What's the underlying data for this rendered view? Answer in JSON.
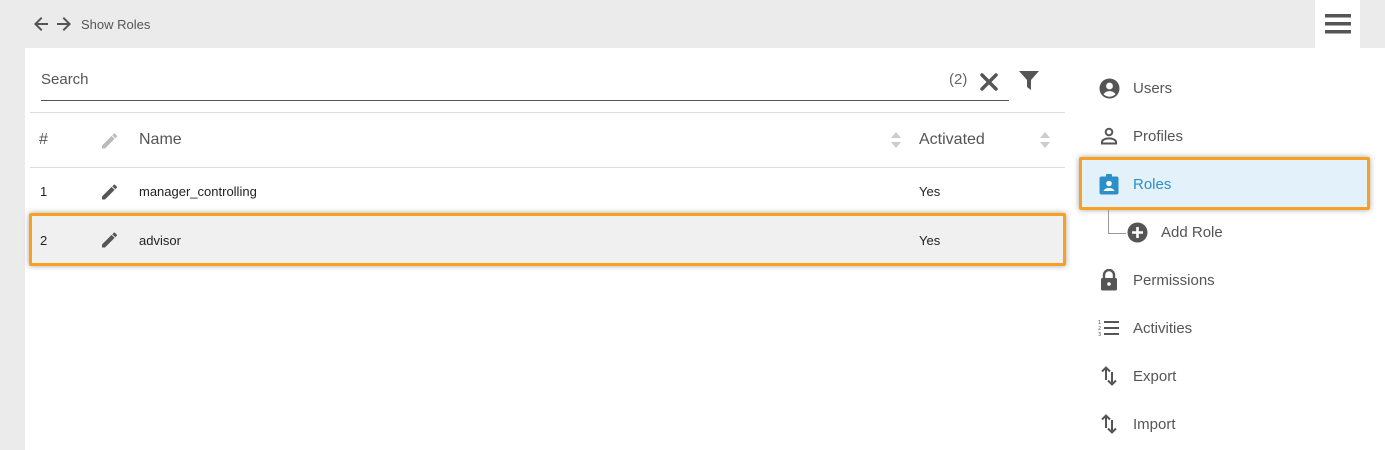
{
  "header": {
    "breadcrumb": "Show Roles"
  },
  "search": {
    "placeholder": "Search",
    "value": "",
    "count": "(2)"
  },
  "table": {
    "columns": {
      "index": "#",
      "name": "Name",
      "activated": "Activated"
    },
    "rows": [
      {
        "index": "1",
        "name": "manager_controlling",
        "activated": "Yes"
      },
      {
        "index": "2",
        "name": "advisor",
        "activated": "Yes"
      }
    ]
  },
  "sidebar": {
    "items": [
      {
        "label": "Users",
        "icon": "account-circle-icon"
      },
      {
        "label": "Profiles",
        "icon": "person-outline-icon"
      },
      {
        "label": "Roles",
        "icon": "badge-icon",
        "active": true
      },
      {
        "label": "Add Role",
        "icon": "add-circle-icon"
      },
      {
        "label": "Permissions",
        "icon": "lock-icon"
      },
      {
        "label": "Activities",
        "icon": "numbered-list-icon"
      },
      {
        "label": "Export",
        "icon": "swap-vertical-icon"
      },
      {
        "label": "Import",
        "icon": "swap-vertical-icon"
      }
    ]
  },
  "colors": {
    "accent": "#2b8fc9",
    "highlight": "#f7a023",
    "selected_bg": "#e3f1fa"
  }
}
